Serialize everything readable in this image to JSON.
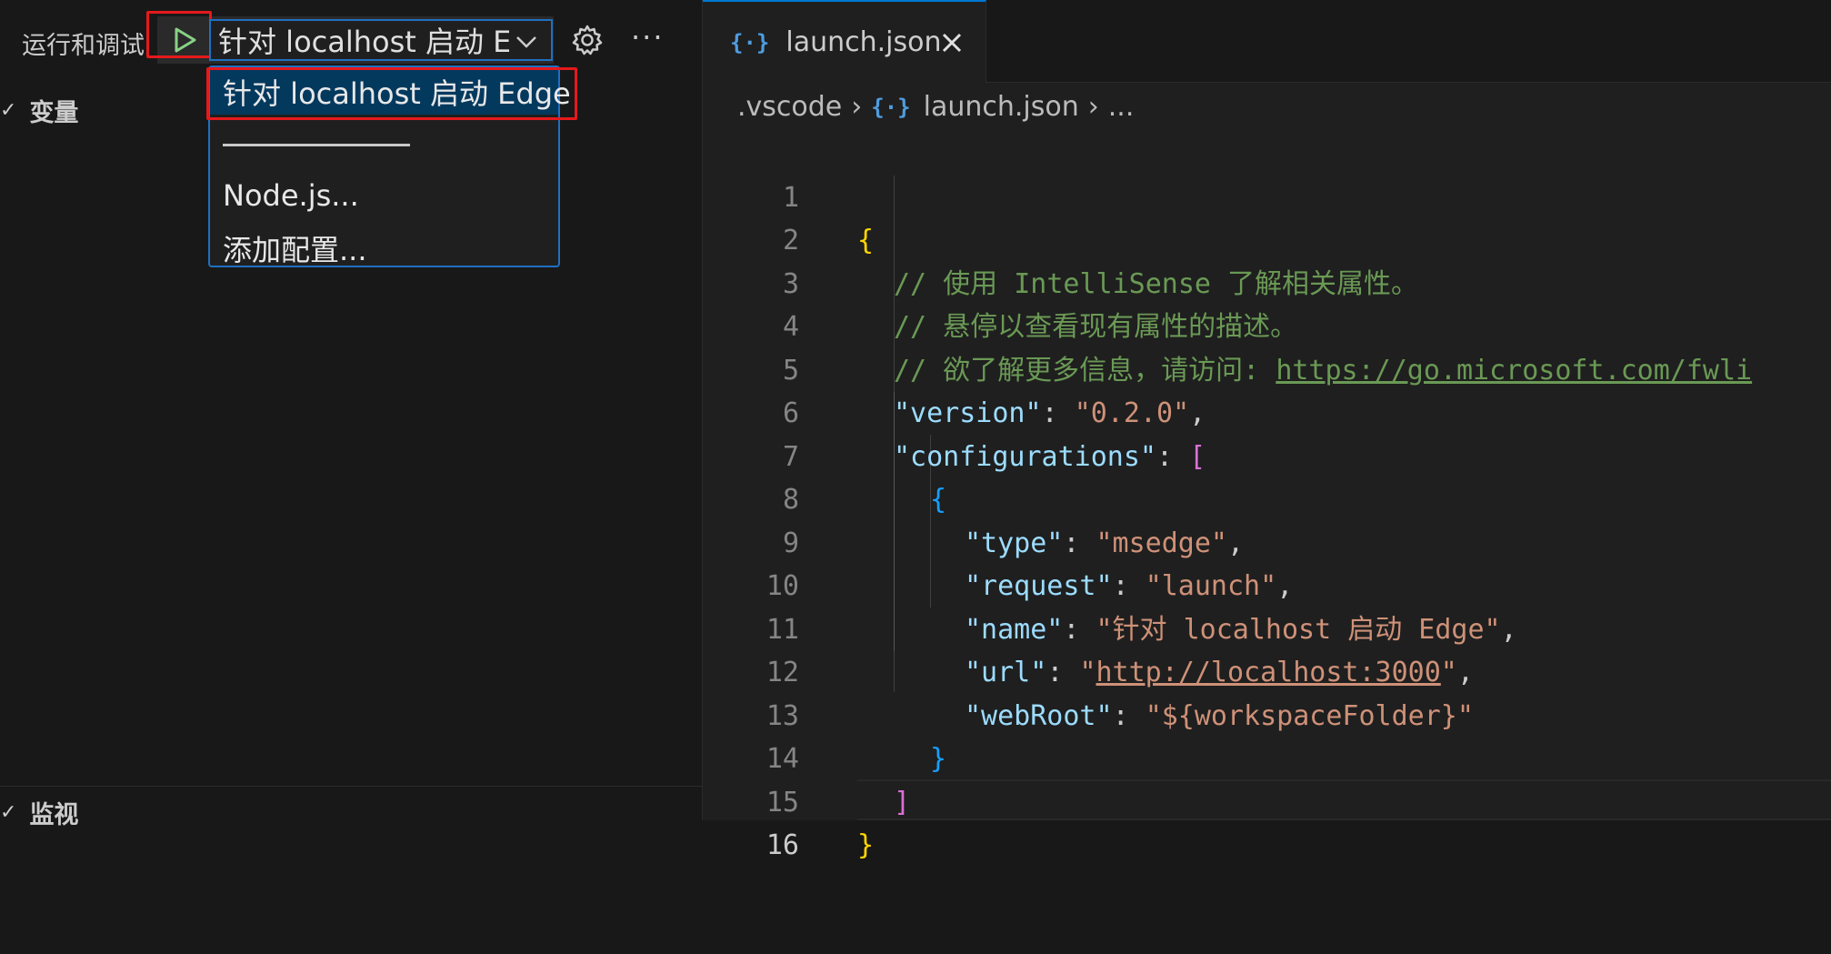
{
  "sidebar": {
    "title": "运行和调试",
    "selected_config": "针对 localhost 启动 E",
    "dropdown": {
      "options": [
        "针对 localhost 启动 Edge",
        "Node.js...",
        "添加配置..."
      ],
      "selected_index": 0
    },
    "sections": {
      "variables": "变量",
      "watch": "监视"
    },
    "more_label": "···"
  },
  "editor": {
    "tab": {
      "label": "launch.json",
      "icon": "json-icon"
    },
    "breadcrumb": {
      "folder": ".vscode",
      "file": "launch.json",
      "more": "..."
    },
    "line_numbers": [
      "1",
      "2",
      "3",
      "4",
      "5",
      "6",
      "7",
      "8",
      "9",
      "10",
      "11",
      "12",
      "13",
      "14",
      "15",
      "16"
    ],
    "active_line": 16,
    "code": {
      "l1_open": "{",
      "l2_comment": "// 使用 IntelliSense 了解相关属性。",
      "l3_comment": "// 悬停以查看现有属性的描述。",
      "l4_comment_prefix": "// 欲了解更多信息，请访问: ",
      "l4_url": "https://go.microsoft.com/fwli",
      "version_key": "\"version\"",
      "version_value": "\"0.2.0\"",
      "configurations_key": "\"configurations\"",
      "bracket_open": "[",
      "obj_open": "{",
      "type_key": "\"type\"",
      "type_value": "\"msedge\"",
      "request_key": "\"request\"",
      "request_value": "\"launch\"",
      "name_key": "\"name\"",
      "name_value": "\"针对 localhost 启动 Edge\"",
      "url_key": "\"url\"",
      "url_value_quote_open": "\"",
      "url_value": "http://localhost:3000",
      "url_value_quote_close": "\"",
      "webroot_key": "\"webRoot\"",
      "webroot_value": "\"${workspaceFolder}\"",
      "obj_close": "}",
      "bracket_close": "]",
      "l15_close": "}",
      "colon": ": ",
      "comma": ","
    }
  },
  "colors": {
    "highlight_outline": "#e5191c",
    "focus_border": "#1f70c1",
    "selected_item_bg": "#04395e",
    "play_icon": "#89d185"
  }
}
